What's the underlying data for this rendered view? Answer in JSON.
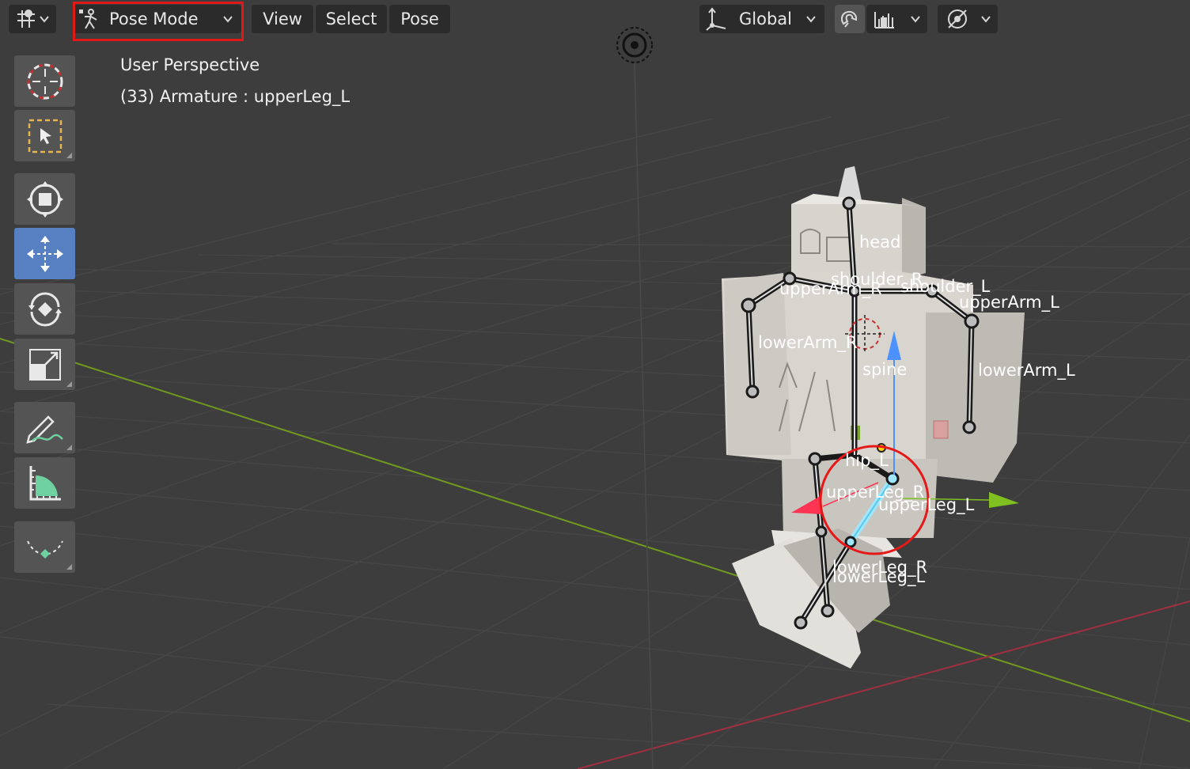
{
  "header": {
    "mode_label": "Pose Mode",
    "menus": [
      "View",
      "Select",
      "Pose"
    ],
    "orientation_label": "Global",
    "icons": {
      "editor_type": "object-editor-icon",
      "mode": "pose-mode-icon",
      "orientation": "transform-orientation-icon",
      "snap": "magnet-icon",
      "snap_target": "snap-increment-icon",
      "proportional": "proportional-editing-icon"
    }
  },
  "overlay": {
    "view_name": "User Perspective",
    "object_info": "(33) Armature : upperLeg_L"
  },
  "toolbar": {
    "tools": [
      "cursor-tool-icon",
      "select-box-tool-icon",
      "transform-tool-icon",
      "move-tool-icon",
      "rotate-tool-icon",
      "scale-tool-icon",
      "annotate-tool-icon",
      "measure-tool-icon",
      "relax-tool-icon"
    ],
    "active_tool": "move-tool-icon"
  },
  "bones": {
    "head": "head",
    "shoulder_r": "shoulder_R",
    "shoulder_l": "shoulder_L",
    "upper_arm_r": "upperArm_R",
    "upper_arm_l": "upperArm_L",
    "lower_arm_r": "lowerArm_R",
    "lower_arm_l": "lowerArm_L",
    "spine": "spine",
    "hip_l": "hip_L",
    "upper_leg_r": "upperLeg_R",
    "upper_leg_l": "upperLeg_L",
    "lower_leg_r": "lowerLeg_R",
    "lower_leg_l": "lowerLeg_L"
  },
  "colors": {
    "viewport_bg": "#3d3d3d",
    "active_tool": "#5680c2",
    "highlight": "#e01818",
    "x_axis": "#a03040",
    "y_axis": "#6f9a1e"
  }
}
